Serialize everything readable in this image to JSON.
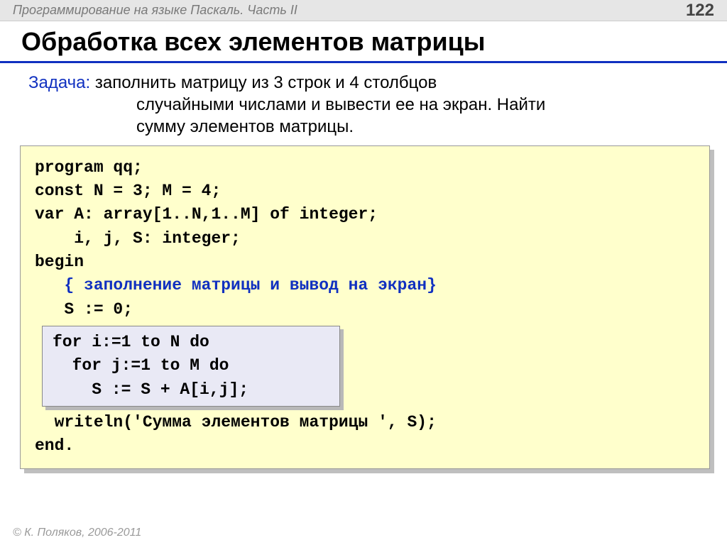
{
  "header": {
    "course": "Программирование на языке Паскаль. Часть II",
    "page": "122"
  },
  "title": "Обработка всех элементов матрицы",
  "task": {
    "label": "Задача:",
    "line1": " заполнить матрицу из 3 строк и 4 столбцов",
    "line2": "случайными числами и вывести ее на экран. Найти",
    "line3": "сумму элементов матрицы."
  },
  "code": {
    "l1": "program qq;",
    "l2": "const N = 3; M = 4;",
    "l3": "var A: array[1..N,1..M] of integer;",
    "l4": "    i, j, S: integer;",
    "l5": "begin",
    "l6": "   { заполнение матрицы и вывод на экран}",
    "l7": "   S := 0;",
    "inner": {
      "l1": "for i:=1 to N do",
      "l2": "  for j:=1 to M do",
      "l3": "    S := S + A[i,j];"
    },
    "l8": "  writeln('Сумма элементов матрицы ', S);",
    "l9": "end."
  },
  "footer": "© К. Поляков, 2006-2011"
}
